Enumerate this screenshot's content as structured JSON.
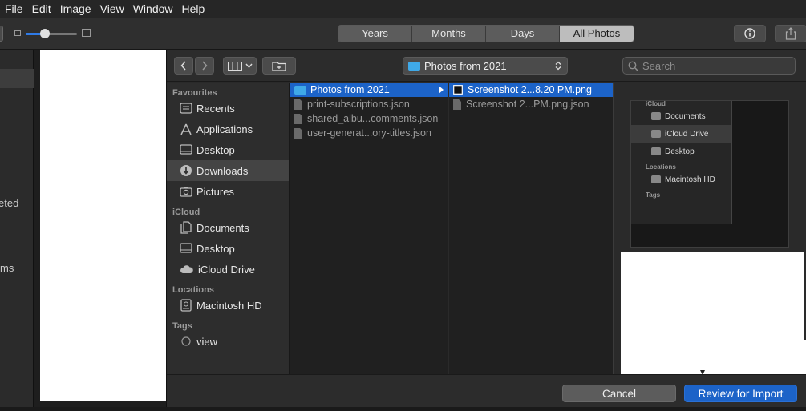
{
  "menubar": {
    "items": [
      "File",
      "Edit",
      "Image",
      "View",
      "Window",
      "Help"
    ]
  },
  "toolbar": {
    "segments": [
      {
        "label": "Years",
        "selected": false
      },
      {
        "label": "Months",
        "selected": false
      },
      {
        "label": "Days",
        "selected": false
      },
      {
        "label": "All Photos",
        "selected": true
      }
    ],
    "icons": [
      "small-photo-icon",
      "large-photo-icon",
      "info-icon",
      "share-icon"
    ]
  },
  "left_partial": {
    "label_deleted": "eted",
    "label_items": "ms"
  },
  "dialog": {
    "location_popup": "Photos from 2021",
    "search_placeholder": "Search",
    "sidebar": {
      "sections": [
        {
          "title": "Favourites",
          "items": [
            {
              "label": "Recents",
              "icon": "recents-icon",
              "selected": false
            },
            {
              "label": "Applications",
              "icon": "applications-icon",
              "selected": false
            },
            {
              "label": "Desktop",
              "icon": "desktop-icon",
              "selected": false
            },
            {
              "label": "Downloads",
              "icon": "downloads-icon",
              "selected": true
            },
            {
              "label": "Pictures",
              "icon": "pictures-icon",
              "selected": false
            }
          ]
        },
        {
          "title": "iCloud",
          "items": [
            {
              "label": "Documents",
              "icon": "documents-icon",
              "selected": false
            },
            {
              "label": "Desktop",
              "icon": "desktop-icon",
              "selected": false
            },
            {
              "label": "iCloud Drive",
              "icon": "cloud-icon",
              "selected": false
            }
          ]
        },
        {
          "title": "Locations",
          "items": [
            {
              "label": "Macintosh HD",
              "icon": "disk-icon",
              "selected": false
            }
          ]
        },
        {
          "title": "Tags",
          "items": [
            {
              "label": "view",
              "icon": "tag-icon",
              "selected": false
            }
          ]
        }
      ]
    },
    "column1": [
      {
        "label": "Photos from 2021",
        "kind": "folder",
        "selected": true
      },
      {
        "label": "print-subscriptions.json",
        "kind": "file",
        "selected": false
      },
      {
        "label": "shared_albu...comments.json",
        "kind": "file",
        "selected": false
      },
      {
        "label": "user-generat...ory-titles.json",
        "kind": "file",
        "selected": false
      }
    ],
    "column2": [
      {
        "label": "Screenshot 2...8.20 PM.png",
        "kind": "image",
        "selected": true
      },
      {
        "label": "Screenshot 2...PM.png.json",
        "kind": "file",
        "selected": false
      }
    ],
    "preview": {
      "sections": [
        {
          "title": "iCloud",
          "items": [
            {
              "label": "Documents",
              "selected": false
            },
            {
              "label": "iCloud Drive",
              "selected": true
            },
            {
              "label": "Desktop",
              "selected": false
            }
          ]
        },
        {
          "title": "Locations",
          "items": [
            {
              "label": "Macintosh HD",
              "selected": false
            }
          ]
        },
        {
          "title": "Tags",
          "items": []
        }
      ]
    },
    "buttons": {
      "cancel": "Cancel",
      "review": "Review for Import"
    },
    "accent": "#1c63c8"
  }
}
